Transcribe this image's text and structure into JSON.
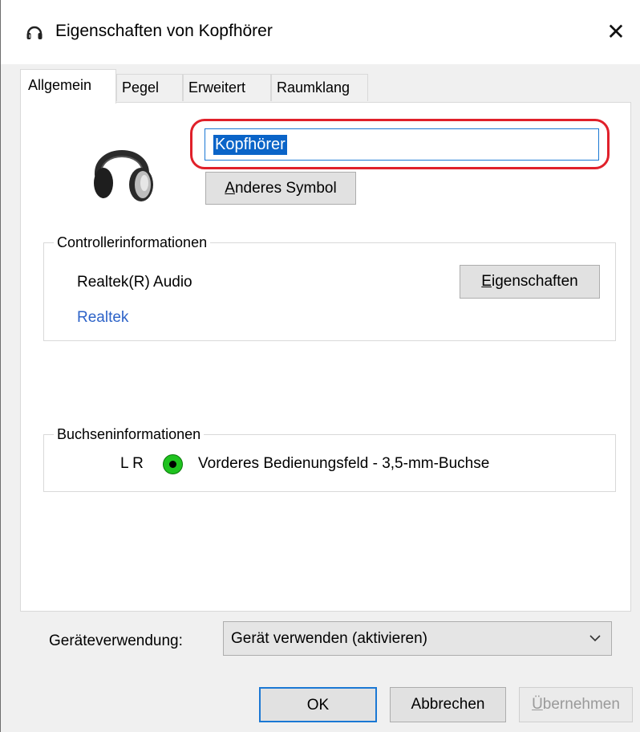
{
  "window": {
    "title": "Eigenschaften von Kopfhörer",
    "close_glyph": "✕",
    "title_icon": "headphones-icon"
  },
  "tabs": [
    {
      "label": "Allgemein",
      "active": true
    },
    {
      "label": "Pegel",
      "active": false
    },
    {
      "label": "Erweitert",
      "active": false
    },
    {
      "label": "Raumklang",
      "active": false
    }
  ],
  "general": {
    "device_icon": "headphones-icon",
    "device_name": "Kopfhörer",
    "highlight_color": "#e0202a",
    "change_icon_button": {
      "accel": "A",
      "rest": "nderes Symbol"
    },
    "controller": {
      "group_label": "Controllerinformationen",
      "name": "Realtek(R) Audio",
      "vendor_link": "Realtek",
      "link_color": "#2d63c8",
      "properties_button": {
        "accel": "E",
        "rest": "igenschaften"
      }
    },
    "jack": {
      "group_label": "Buchseninformationen",
      "channels": "L R",
      "color": "#1fc21f",
      "description": "Vorderes Bedienungsfeld - 3,5-mm-Buchse"
    },
    "usage": {
      "label": "Geräteverwendung:",
      "selected": "Gerät verwenden (aktivieren)"
    }
  },
  "footer": {
    "ok": "OK",
    "cancel": "Abbrechen",
    "apply": {
      "accel": "Ü",
      "rest": "bernehmen",
      "disabled": true
    }
  }
}
